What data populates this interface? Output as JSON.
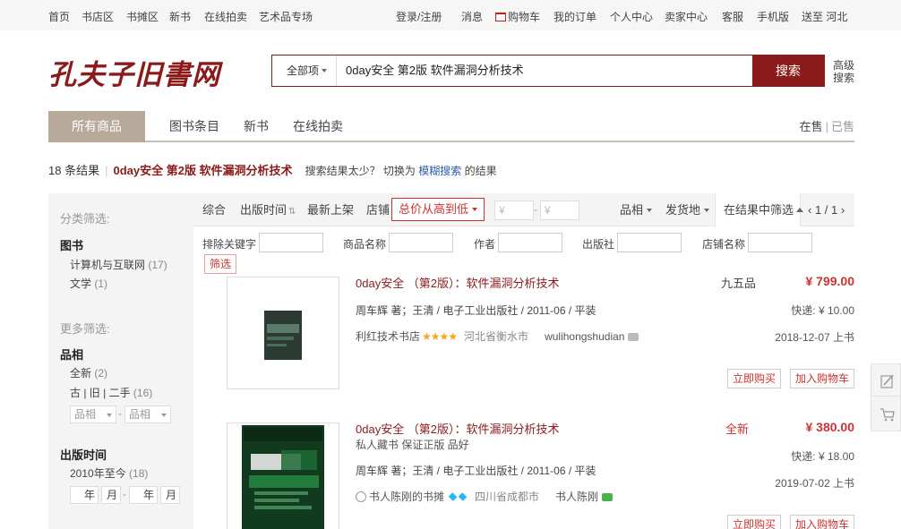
{
  "topbar": {
    "left": [
      "首页",
      "书店区",
      "书摊区",
      "新书",
      "在线拍卖",
      "艺术品专场"
    ],
    "login": "登录/注册",
    "messages": "消息",
    "cart": "购物车",
    "orders": "我的订单",
    "personal": "个人中心",
    "seller_center": "卖家中心",
    "service": "客服",
    "mobile": "手机版",
    "deliver_to": "送至 河北"
  },
  "logo": "孔夫子旧書网",
  "search": {
    "scope": "全部项",
    "query": "0day安全  第2版  软件漏洞分析技术",
    "button": "搜索",
    "advanced": "高级搜索"
  },
  "tabs": {
    "items": [
      "所有商品",
      "图书条目",
      "新书",
      "在线拍卖"
    ],
    "on_sale": "在售",
    "sold": "已售"
  },
  "results": {
    "count": "18 条结果",
    "keyword": "0day安全 第2版 软件漏洞分析技术",
    "hint_before": "搜索结果太少？ 切换为",
    "fuzzy": "模糊搜索",
    "hint_after": "的结果"
  },
  "sidebar": {
    "category_title": "分类筛选:",
    "category_head": "图书",
    "categories": [
      {
        "label": "计算机与互联网",
        "count": "(17)"
      },
      {
        "label": "文学",
        "count": "(1)"
      }
    ],
    "more_title": "更多筛选:",
    "condition_head": "品相",
    "conditions": [
      {
        "label": "全新",
        "count": "(2)"
      },
      {
        "label": "古 | 旧 | 二手",
        "count": "(16)"
      }
    ],
    "condition_select": "品相",
    "date_head": "出版时间",
    "date_range": {
      "label": "2010年至今",
      "count": "(18)"
    },
    "year_unit": "年",
    "month_unit": "月"
  },
  "sortbar": {
    "overall": "综合",
    "pubdate": "出版时间",
    "newest": "最新上架",
    "shop": "店铺",
    "price_sort": "总价从高到低",
    "price_placeholder": "¥",
    "condition": "品相",
    "ship_from": "发货地",
    "within": "在结果中筛选",
    "pager": "1 / 1"
  },
  "filters": {
    "exclude": "排除关键字",
    "name": "商品名称",
    "author": "作者",
    "publisher": "出版社",
    "shop_name": "店铺名称",
    "button": "筛选"
  },
  "products": [
    {
      "title": "0day安全 （第2版）：软件漏洞分析技术",
      "subtitle": "",
      "meta": "周车辉 著；王清    / 电子工业出版社 / 2011-06 / 平装",
      "shop": "利红技术书店",
      "stars": "★★★★",
      "location": "河北省衡水市",
      "seller": "wulihongshudian",
      "condition": "九五品",
      "price": "¥ 799.00",
      "shipping": "快递: ¥ 10.00",
      "date": "2018-12-07 上书",
      "buy": "立即购买",
      "cart": "加入购物车"
    },
    {
      "title": "0day安全 （第2版）：软件漏洞分析技术",
      "subtitle": "私人藏书 保证正版 品好",
      "meta": "周车辉 著；王清    / 电子工业出版社 / 2011-06 / 平装",
      "shop": "书人陈刚的书摊",
      "stars": "",
      "location": "四川省成都市",
      "seller": "书人陈刚",
      "condition": "全新",
      "price": "¥ 380.00",
      "shipping": "快递: ¥ 18.00",
      "date": "2019-07-02 上书",
      "buy": "立即购买",
      "cart": "加入购物车"
    }
  ],
  "colors": {
    "brand": "#8b1a1a",
    "accent": "#cc3333",
    "tab_active": "#b8aa9b"
  }
}
